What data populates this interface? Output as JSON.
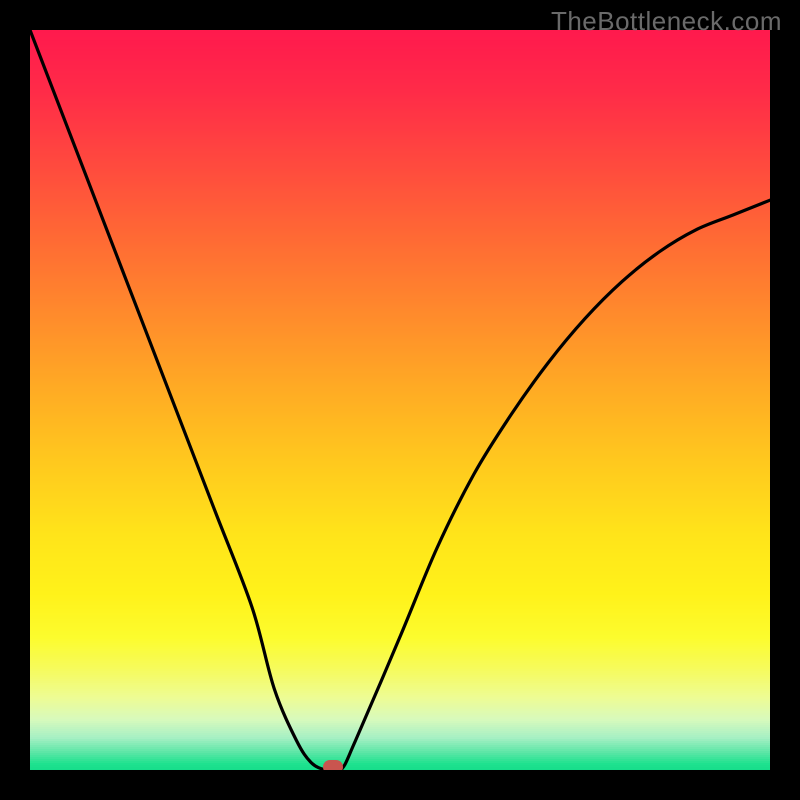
{
  "watermark": "TheBottleneck.com",
  "chart_data": {
    "type": "line",
    "title": "",
    "xlabel": "",
    "ylabel": "",
    "xlim": [
      0,
      100
    ],
    "ylim": [
      0,
      100
    ],
    "x": [
      0,
      5,
      10,
      15,
      20,
      25,
      30,
      33,
      36,
      38,
      40,
      42,
      44,
      50,
      55,
      60,
      65,
      70,
      75,
      80,
      85,
      90,
      95,
      100
    ],
    "values": [
      100,
      87,
      74,
      61,
      48,
      35,
      22,
      11,
      4,
      1,
      0,
      0,
      4,
      18,
      30,
      40,
      48,
      55,
      61,
      66,
      70,
      73,
      75,
      77
    ],
    "optimal_x": 41,
    "optimal_y": 0,
    "gradient_stops": [
      {
        "pos": 0.0,
        "color": "#ff1a4d"
      },
      {
        "pos": 0.08,
        "color": "#ff2b48"
      },
      {
        "pos": 0.18,
        "color": "#ff4a3e"
      },
      {
        "pos": 0.28,
        "color": "#ff6a34"
      },
      {
        "pos": 0.38,
        "color": "#ff8a2c"
      },
      {
        "pos": 0.48,
        "color": "#ffaa24"
      },
      {
        "pos": 0.58,
        "color": "#ffc81e"
      },
      {
        "pos": 0.68,
        "color": "#ffe41a"
      },
      {
        "pos": 0.76,
        "color": "#fff21a"
      },
      {
        "pos": 0.82,
        "color": "#fcfc2e"
      },
      {
        "pos": 0.86,
        "color": "#f6fb5a"
      },
      {
        "pos": 0.9,
        "color": "#eefc93"
      },
      {
        "pos": 0.93,
        "color": "#d8fabc"
      },
      {
        "pos": 0.955,
        "color": "#a6f0c4"
      },
      {
        "pos": 0.975,
        "color": "#5be6a6"
      },
      {
        "pos": 0.99,
        "color": "#1fe28f"
      },
      {
        "pos": 1.0,
        "color": "#15dd8a"
      }
    ],
    "marker_color": "#c9554f",
    "curve_color": "#000000"
  }
}
